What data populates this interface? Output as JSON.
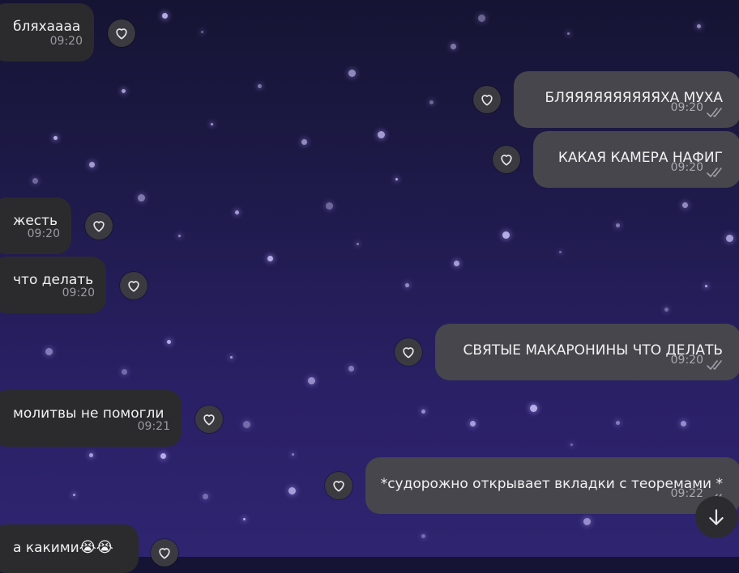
{
  "messages": [
    {
      "id": "m1",
      "dir": "in",
      "text": "бляхаааа",
      "time": "09:20"
    },
    {
      "id": "m2",
      "dir": "out",
      "text": "БЛЯЯЯЯЯЯЯЯЯЯХА МУХА",
      "time": "09:20"
    },
    {
      "id": "m3",
      "dir": "out",
      "text": "КАКАЯ КАМЕРА НАФИГ",
      "time": "09:20"
    },
    {
      "id": "m4",
      "dir": "in",
      "text": "жесть",
      "time": "09:20"
    },
    {
      "id": "m5",
      "dir": "in",
      "text": "что делать",
      "time": "09:20"
    },
    {
      "id": "m6",
      "dir": "out",
      "text": "СВЯТЫЕ МАКАРОНИНЫ ЧТО ДЕЛАТЬ",
      "time": "09:20"
    },
    {
      "id": "m7",
      "dir": "in",
      "text": "молитвы не помогли",
      "time": "09:21"
    },
    {
      "id": "m8",
      "dir": "out",
      "text": "*судорожно открывает вкладки с теоремами *",
      "time": "09:22"
    },
    {
      "id": "m9",
      "dir": "in",
      "text": "а какими",
      "emoji": "😭😭"
    }
  ],
  "icons": {
    "reaction": "heart-icon",
    "read": "double-check-icon",
    "scroll": "arrow-down-icon"
  },
  "colors": {
    "bubble_in": "#2b2b2e",
    "bubble_out": "#46464c",
    "background": "#1e1a4a"
  }
}
